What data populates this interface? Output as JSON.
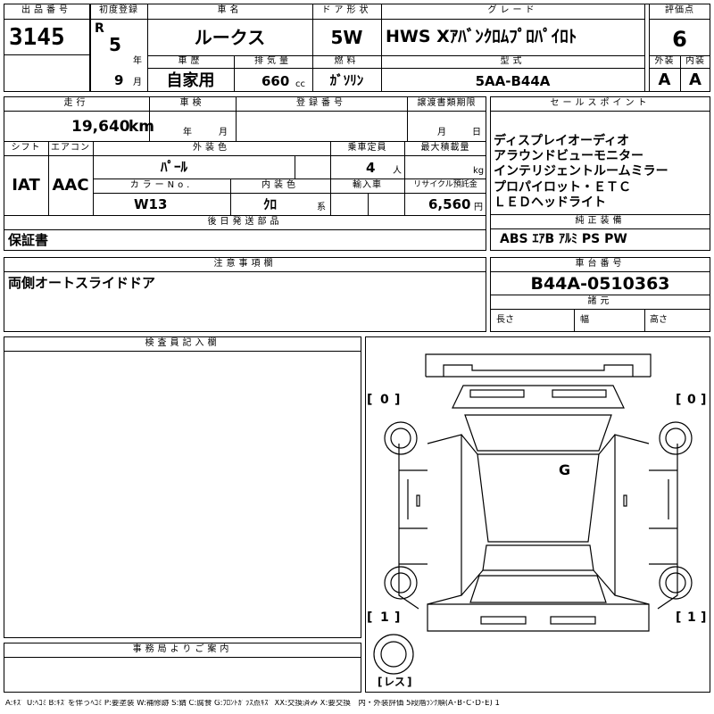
{
  "header": {
    "lot_label": "出品番号",
    "lot_no": "3145",
    "first_reg_label": "初度登録",
    "era": "R",
    "year": "5",
    "year_unit": "年",
    "month": "9",
    "month_unit": "月",
    "car_name_label": "車名",
    "car_name": "ルークス",
    "door_label": "ドア形状",
    "door": "5W",
    "grade_label": "グレード",
    "grade": "HWS Xｱﾊﾞﾝｸﾛﾑﾌﾟﾛﾊﾟｲﾛﾄ",
    "score_label": "評価点",
    "score": "6",
    "history_label": "車歴",
    "history": "自家用",
    "displacement_label": "排気量",
    "displacement": "660",
    "displacement_unit": "cc",
    "fuel_label": "燃料",
    "fuel": "ｶﾞｿﾘﾝ",
    "model_label": "型式",
    "model": "5AA-B44A",
    "ext_label": "外装",
    "ext_grade": "A",
    "int_label": "内装",
    "int_grade": "A"
  },
  "mid": {
    "mileage_label": "走行",
    "mileage": "19,640",
    "mileage_unit": "km",
    "inspection_label": "車検",
    "year_unit": "年",
    "month_unit": "月",
    "reg_no_label": "登録番号",
    "transfer_label": "譲渡書類期限",
    "day_unit": "日",
    "shift_label": "シフト",
    "shift": "IAT",
    "ac_label": "エアコン",
    "ac": "AAC",
    "color_label": "外装色",
    "color": "ﾊﾟｰﾙ",
    "capacity_label": "乗車定員",
    "capacity": "4",
    "capacity_unit": "人",
    "load_label": "最大積載量",
    "load_unit": "kg",
    "color_no_label": "カラーNo.",
    "color_no": "W13",
    "int_color_label": "内装色",
    "int_color": "ｸﾛ",
    "int_color_suffix": "系",
    "import_label": "輸入車",
    "recycle_label": "リサイクル預託金",
    "recycle": "6,560",
    "recycle_unit": "円",
    "later_label": "後日発送部品",
    "later": "保証書"
  },
  "sales": {
    "label": "セールスポイント",
    "points": [
      "ディスプレイオーディオ",
      "アラウンドビューモニター",
      "インテリジェントルームミラー",
      "プロパイロット・ＥＴＣ",
      "ＬＥＤヘッドライト"
    ],
    "equip_label": "純正装備",
    "equip": "ABS ｴｱB ｱﾙﾐ PS PW"
  },
  "notes": {
    "label": "注意事項欄",
    "text": "両側オートスライドドア"
  },
  "chassis": {
    "label": "車台番号",
    "number": "B44A-0510363",
    "spec_label": "諸元",
    "length_label": "長さ",
    "width_label": "幅",
    "height_label": "高さ"
  },
  "inspector": {
    "label": "検査員記入欄"
  },
  "office": {
    "label": "事務局よりご案内"
  },
  "diagram": {
    "front_left": "0",
    "front_right": "0",
    "rear_left": "1",
    "rear_right": "1",
    "spare": "レス",
    "roof_mark": "G"
  },
  "legend": "A:ｷｽﾞ U:ﾍｺﾐ B:ｷｽﾞを伴うﾍｺﾐ P:要塗装 W:補修跡 S:錆 C:腐食 G:ﾌﾛﾝﾄｶﾞﾗｽ点ｷｽﾞ XX:交換済み X:要交換　内・外装評価 5段階ﾗﾝｸ順(A･B･C･D･E) 1"
}
